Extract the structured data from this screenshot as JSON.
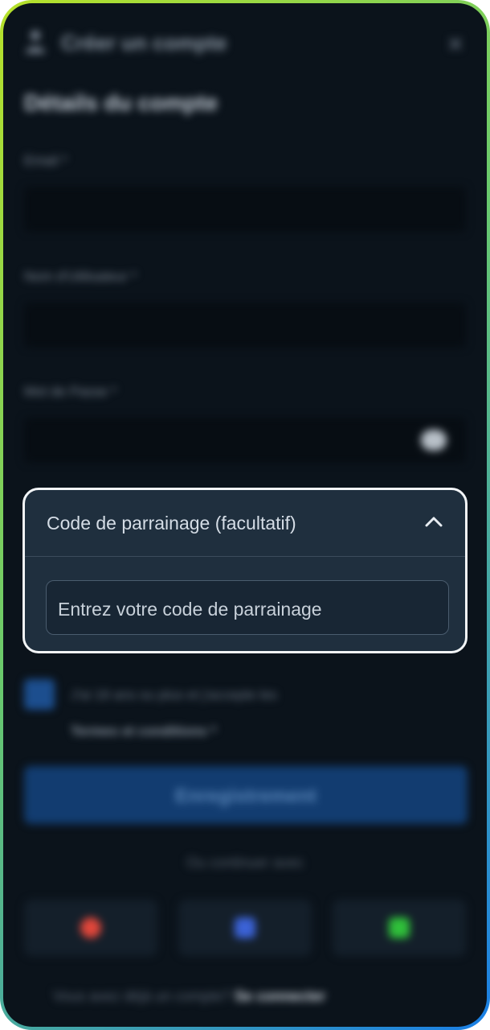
{
  "app": {
    "header_title": "Créer un compte",
    "section_title": "Détails du compte"
  },
  "form": {
    "email_label": "Email *",
    "username_label": "Nom d'Utilisateur *",
    "password_label": "Mot de Passe *",
    "consent_text": "J'ai 18 ans ou plus et j'accepte les",
    "terms_link": "Termes et conditions *",
    "register_label": "Enregistrement",
    "or_text": "Ou continuer avec"
  },
  "referral": {
    "title": "Code de parrainage (facultatif)",
    "placeholder": "Entrez votre code de parrainage"
  },
  "social": {
    "icons": [
      "google-icon",
      "facebook-icon",
      "line-icon"
    ],
    "colors": [
      "#e0463a",
      "#3b62d6",
      "#2fbf3a"
    ]
  },
  "footer": {
    "text": "Vous avez déjà un compte?",
    "link": "Se connecter"
  },
  "colors": {
    "background": "#0b131b",
    "accordion_bg": "#1f2f3e",
    "accordion_border": "#f2f5f7",
    "register_button": "#123c70",
    "device_gradient": [
      "#b7e12a",
      "#1a7fe6"
    ]
  }
}
